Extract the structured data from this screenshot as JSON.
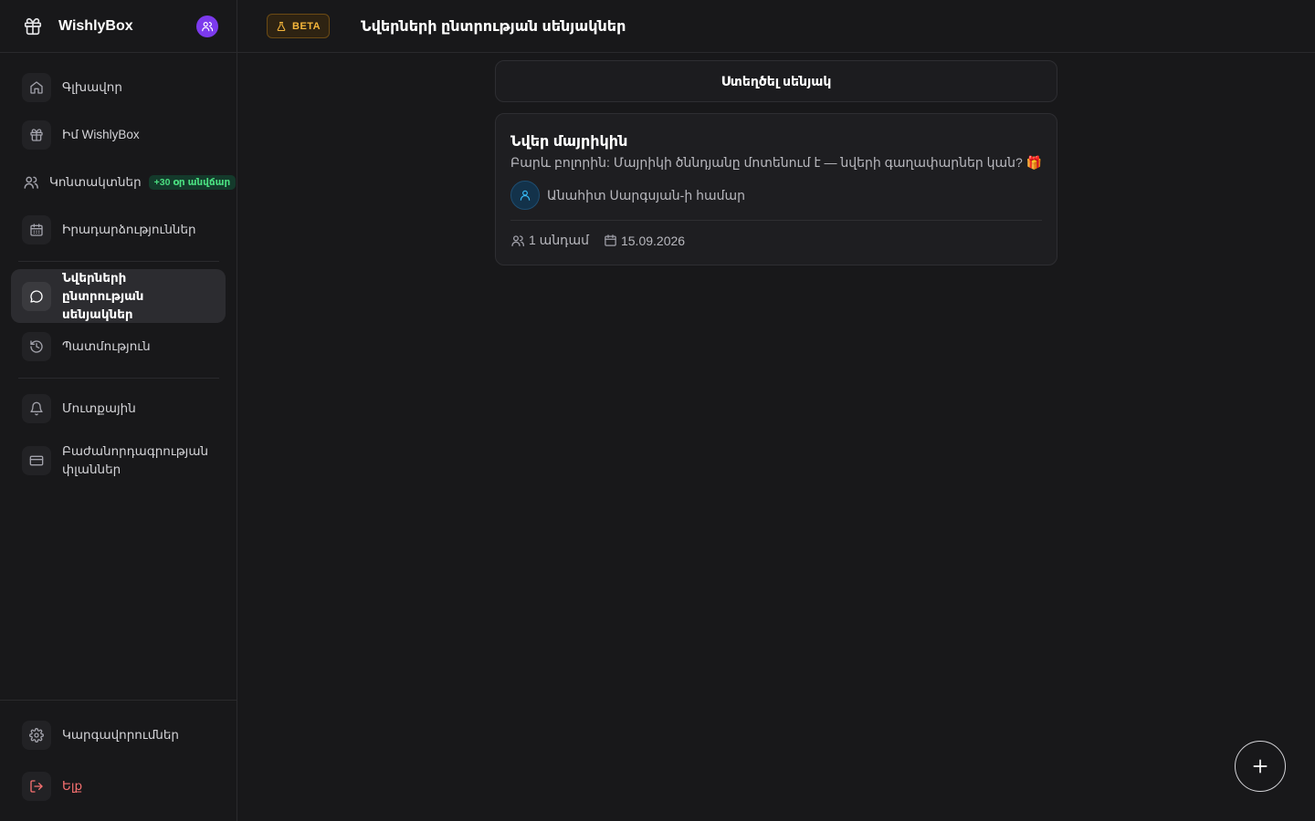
{
  "app": {
    "name": "WishlyBox"
  },
  "sidebar": {
    "items": [
      {
        "label": "Գլխավոր",
        "icon": "home-icon"
      },
      {
        "label": "Իմ WishlyBox",
        "icon": "gift-icon"
      },
      {
        "label": "Կոնտակտներ",
        "icon": "users-icon",
        "badge": "+30 օր անվճար"
      },
      {
        "label": "Իրադարձություններ",
        "icon": "calendar-icon"
      },
      {
        "label": "Նվերների ընտրության սենյակներ",
        "icon": "chat-icon",
        "active": true
      },
      {
        "label": "Պատմություն",
        "icon": "history-icon"
      },
      {
        "label": "Մուտքային",
        "icon": "bell-icon"
      },
      {
        "label": "Բաժանորդագրության փլաններ",
        "icon": "card-icon"
      }
    ],
    "settings_label": "Կարգավորումներ",
    "logout_label": "Ելք"
  },
  "header": {
    "badge": "BETA",
    "title": "Նվերների ընտրության սենյակներ"
  },
  "main": {
    "create_button": "Ստեղծել սենյակ",
    "rooms": [
      {
        "title": "Նվեր մայրիկին",
        "description": "Բարև բոլորին: Մայրիկի ծննդյանը մոտենում է — նվերի գաղափարներ կան? 🎁",
        "recipient": "Անահիտ Սարգսյան-ի համար",
        "members": "1 անդամ",
        "date": "15.09.2026"
      }
    ]
  },
  "colors": {
    "accent": "#7c3aed",
    "beta": "#f5b63b",
    "badge": "#4ade80",
    "danger": "#f87171"
  }
}
